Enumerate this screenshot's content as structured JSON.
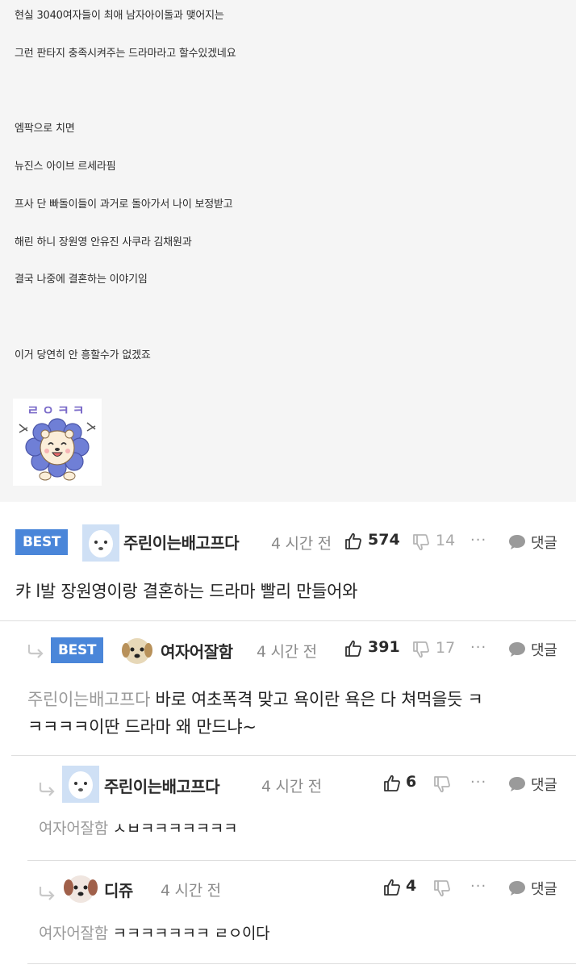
{
  "post": {
    "lines": [
      "현실 3040여자들이 최애 남자아이돌과 맺어지는",
      "그런 판타지 충족시켜주는 드라마라고 할수있겠네요",
      "엠팍으로 치면",
      "뉴진스 아이브 르세라핌",
      "프사 단 빠돌이들이 과거로 돌아가서 나이 보정받고",
      "해린 하니 장원영 안유진 사쿠라 김채원과",
      "결국 나중에 결혼하는 이야기임",
      "이거 당연히 안 흥할수가 없겠죠"
    ],
    "sticker_text": "ㄹㅇㅋㅋ"
  },
  "comments": [
    {
      "best_label": "BEST",
      "nickname": "주린이는배고프다",
      "time": "4 시간 전",
      "likes": "574",
      "dislikes": "14",
      "more": "···",
      "reply_label": "댓글",
      "text": "캬   l발 장원영이랑 결혼하는 드라마 빨리 만들어와"
    },
    {
      "best_label": "BEST",
      "nickname": "여자어잘함",
      "time": "4 시간 전",
      "likes": "391",
      "dislikes": "17",
      "more": "···",
      "reply_label": "댓글",
      "mention": "주린이는배고프다",
      "text_line1": " 바로 여초폭격 맞고 욕이란 욕은 다 쳐먹을듯 ㅋ",
      "text_line2": "ㅋㅋㅋㅋ이딴 드라마 왜 만드냐~"
    },
    {
      "nickname": "주린이는배고프다",
      "time": "4 시간 전",
      "likes": "6",
      "more": "···",
      "reply_label": "댓글",
      "mention": "여자어잘함",
      "text": " ㅅㅂㅋㅋㅋㅋㅋㅋㅋ"
    },
    {
      "nickname": "디쥬",
      "time": "4 시간 전",
      "likes": "4",
      "more": "···",
      "reply_label": "댓글",
      "mention": "여자어잘함",
      "text": " ㅋㅋㅋㅋㅋㅋㅋ ㄹㅇ이다"
    }
  ],
  "colors": {
    "best_badge": "#4a86d9",
    "post_background": "#f5f5f5",
    "mention": "#9a9a9a"
  }
}
